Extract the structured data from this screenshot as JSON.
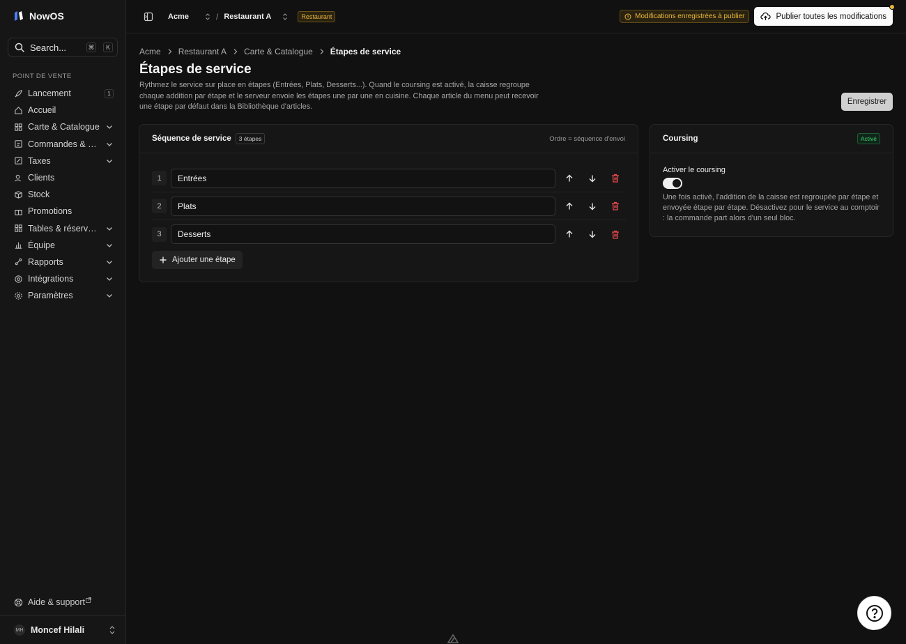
{
  "app": {
    "name": "NowOS"
  },
  "search": {
    "placeholder": "Search...",
    "shortcut_mod": "⌘",
    "shortcut_key": "K"
  },
  "sidebar": {
    "section_title": "POINT DE VENTE",
    "items": [
      {
        "label": "Lancement",
        "icon": "rocket-icon",
        "badge": "1"
      },
      {
        "label": "Accueil",
        "icon": "home-icon"
      },
      {
        "label": "Carte & Catalogue",
        "icon": "grid-icon",
        "expandable": true
      },
      {
        "label": "Commandes & pai...",
        "icon": "receipt-icon",
        "expandable": true
      },
      {
        "label": "Taxes",
        "icon": "percent-icon",
        "expandable": true
      },
      {
        "label": "Clients",
        "icon": "users-icon"
      },
      {
        "label": "Stock",
        "icon": "box-icon"
      },
      {
        "label": "Promotions",
        "icon": "gift-icon"
      },
      {
        "label": "Tables & réservati...",
        "icon": "table-grid-icon",
        "expandable": true
      },
      {
        "label": "Équipe",
        "icon": "chart-icon",
        "expandable": true
      },
      {
        "label": "Rapports",
        "icon": "report-icon",
        "expandable": true
      },
      {
        "label": "Intégrations",
        "icon": "plug-icon",
        "expandable": true
      },
      {
        "label": "Paramètres",
        "icon": "gear-icon",
        "expandable": true
      }
    ],
    "help_label": "Aide & support",
    "user": {
      "initials": "MH",
      "name": "Moncef Hilali"
    }
  },
  "topbar": {
    "org": "Acme",
    "location": "Restaurant A",
    "location_type": "Restaurant",
    "pending_label": "Modifications enregistrées à publier",
    "publish_label": "Publier toutes les modifications"
  },
  "breadcrumb": [
    "Acme",
    "Restaurant A",
    "Carte & Catalogue",
    "Étapes de service"
  ],
  "page": {
    "title": "Étapes de service",
    "description": "Rythmez le service sur place en étapes (Entrées, Plats, Desserts...). Quand le coursing est activé, la caisse regroupe chaque addition par étape et le serveur envoie les étapes une par une en cuisine. Chaque article du menu peut recevoir une étape par défaut dans la Bibliothèque d'articles.",
    "save_label": "Enregistrer"
  },
  "sequence": {
    "title": "Séquence de service",
    "count_label": "3 étapes",
    "order_note": "Ordre = séquence d'envoi",
    "stages": [
      {
        "number": "1",
        "name": "Entrées"
      },
      {
        "number": "2",
        "name": "Plats"
      },
      {
        "number": "3",
        "name": "Desserts"
      }
    ],
    "add_label": "Ajouter une étape"
  },
  "coursing": {
    "title": "Coursing",
    "status": "Activé",
    "toggle_label": "Activer le coursing",
    "enabled": true,
    "description": "Une fois activé, l'addition de la caisse est regroupée par étape et envoyée étape par étape. Désactivez pour le service au comptoir : la commande part alors d'un seul bloc."
  },
  "colors": {
    "accent_warning": "#e8b73a",
    "accent_success": "#3ecf6e",
    "danger": "#e5484d"
  }
}
